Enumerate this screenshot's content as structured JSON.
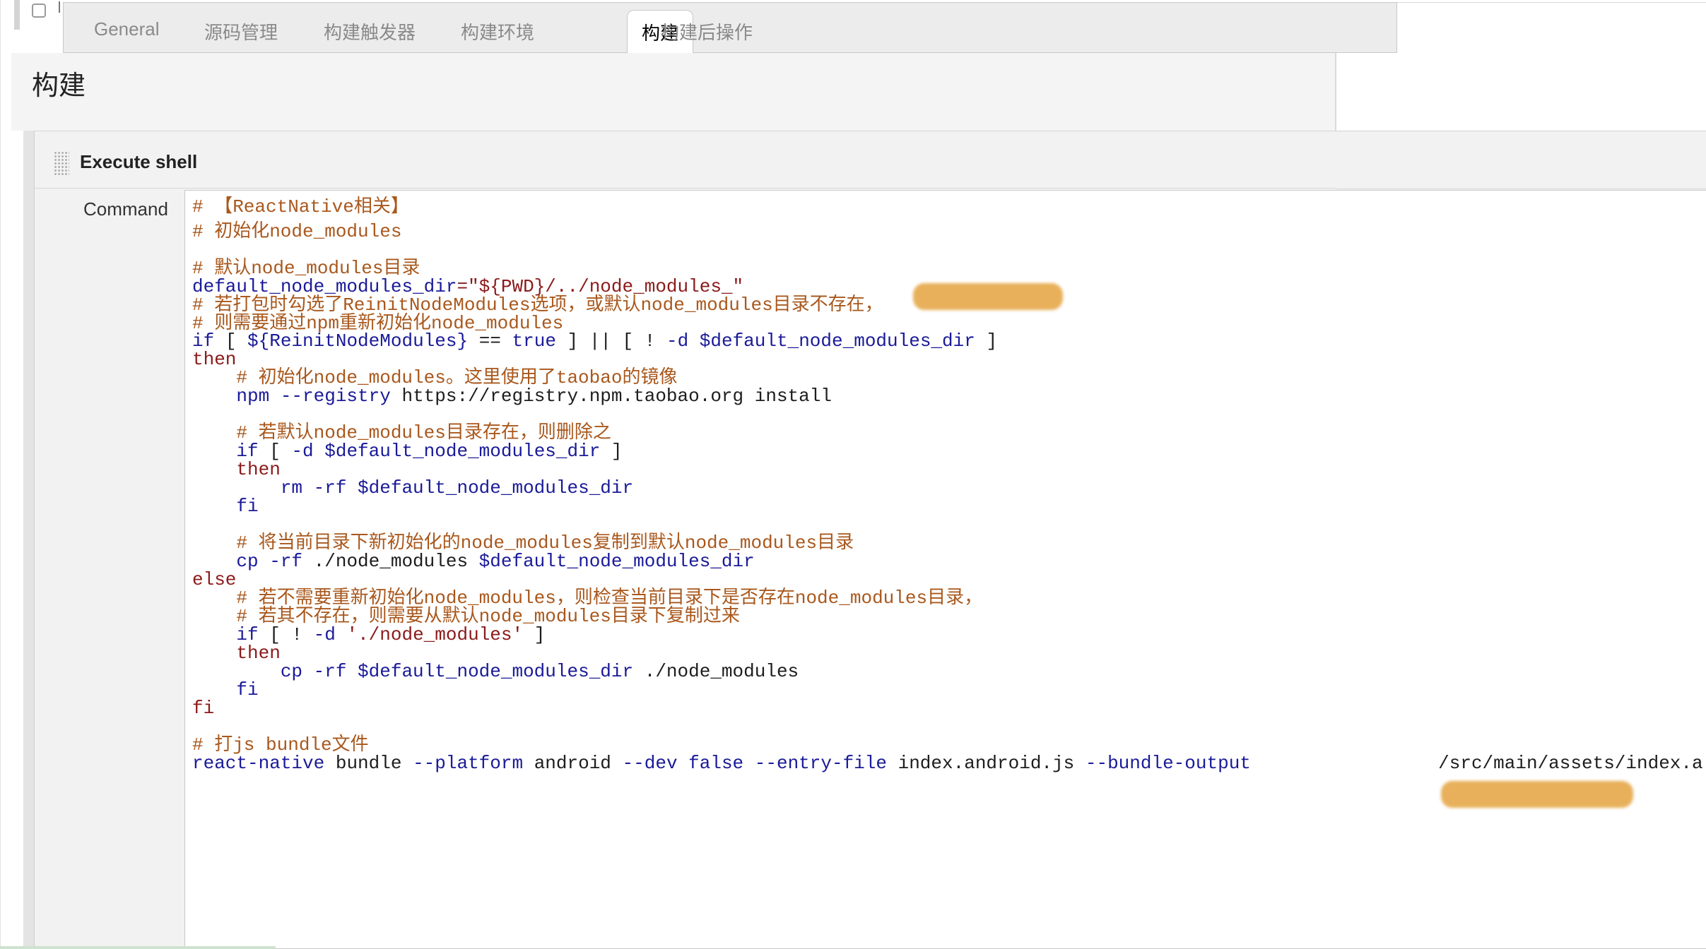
{
  "tabs": [
    "General",
    "源码管理",
    "构建触发器",
    "构建环境",
    "构建",
    "构建后操作"
  ],
  "active_tab": "构建",
  "section": {
    "title": "构建"
  },
  "step": {
    "title": "Execute shell",
    "command_label": "Command"
  },
  "icons": {
    "drag_handle": "drag-handle-icon"
  },
  "redaction_color": "#e8b05a",
  "code_lines": [
    [
      {
        "t": "# 【ReactNative相关】",
        "c": "cm"
      }
    ],
    [
      {
        "t": "# 初始化node_modules",
        "c": "cm"
      }
    ],
    [
      {
        "t": "# 默认node_modules目录",
        "c": "cm"
      }
    ],
    [
      {
        "t": "default_node_modules_dir",
        "c": "kw"
      },
      {
        "t": "=\"${PWD}/../node_modules_",
        "c": "st"
      },
      {
        "t": "\"",
        "c": "st"
      }
    ],
    [
      {
        "t": "# 若打包时勾选了ReinitNodeModules选项，或默认node_modules目录不存在，",
        "c": "cm"
      }
    ],
    [
      {
        "t": "# 则需要通过npm重新初始化node_modules",
        "c": "cm"
      }
    ],
    [
      {
        "t": "if",
        "c": "kw"
      },
      {
        "t": " [ ",
        "c": "pl"
      },
      {
        "t": "${ReinitNodeModules}",
        "c": "kw"
      },
      {
        "t": " == ",
        "c": "pl"
      },
      {
        "t": "true",
        "c": "kw"
      },
      {
        "t": " ] || [ ! ",
        "c": "pl"
      },
      {
        "t": "-d $default_node_modules_dir",
        "c": "kw"
      },
      {
        "t": " ]",
        "c": "pl"
      }
    ],
    [
      {
        "t": "then",
        "c": "st"
      }
    ],
    [
      {
        "t": "    # 初始化node_modules。这里使用了taobao的镜像",
        "c": "cm"
      }
    ],
    [
      {
        "t": "    npm --registry",
        "c": "kw"
      },
      {
        "t": " https://registry.npm.taobao.org install",
        "c": "pl"
      }
    ],
    [
      {
        "t": "    # 若默认node_modules目录存在，则删除之",
        "c": "cm"
      }
    ],
    [
      {
        "t": "    if",
        "c": "kw"
      },
      {
        "t": " [ ",
        "c": "pl"
      },
      {
        "t": "-d $default_node_modules_dir",
        "c": "kw"
      },
      {
        "t": " ]",
        "c": "pl"
      }
    ],
    [
      {
        "t": "    then",
        "c": "st"
      }
    ],
    [
      {
        "t": "        rm -rf $default_node_modules_dir",
        "c": "kw"
      }
    ],
    [
      {
        "t": "    fi",
        "c": "kw"
      }
    ],
    [
      {
        "t": "    # 将当前目录下新初始化的node_modules复制到默认node_modules目录",
        "c": "cm"
      }
    ],
    [
      {
        "t": "    cp -rf",
        "c": "kw"
      },
      {
        "t": " ./node_modules ",
        "c": "pl"
      },
      {
        "t": "$default_node_modules_dir",
        "c": "kw"
      }
    ],
    [
      {
        "t": "else",
        "c": "st"
      }
    ],
    [
      {
        "t": "    # 若不需要重新初始化node_modules，则检查当前目录下是否存在node_modules目录，",
        "c": "cm"
      }
    ],
    [
      {
        "t": "    # 若其不存在，则需要从默认node_modules目录下复制过来",
        "c": "cm"
      }
    ],
    [
      {
        "t": "    if",
        "c": "kw"
      },
      {
        "t": " [ ! ",
        "c": "pl"
      },
      {
        "t": "-d",
        "c": "kw"
      },
      {
        "t": " ",
        "c": "pl"
      },
      {
        "t": "'./node_modules'",
        "c": "st"
      },
      {
        "t": " ]",
        "c": "pl"
      }
    ],
    [
      {
        "t": "    then",
        "c": "st"
      }
    ],
    [
      {
        "t": "        cp -rf $default_node_modules_dir",
        "c": "kw"
      },
      {
        "t": " ./node_modules",
        "c": "pl"
      }
    ],
    [
      {
        "t": "    fi",
        "c": "kw"
      }
    ],
    [
      {
        "t": "fi",
        "c": "st"
      }
    ],
    [
      {
        "t": "# 打js bundle文件",
        "c": "cm"
      }
    ],
    [
      {
        "t": "react-native",
        "c": "kw"
      },
      {
        "t": " bundle ",
        "c": "pl"
      },
      {
        "t": "--platform",
        "c": "kw"
      },
      {
        "t": " android ",
        "c": "pl"
      },
      {
        "t": "--dev false --entry-file",
        "c": "kw"
      },
      {
        "t": " index.android.js ",
        "c": "pl"
      },
      {
        "t": "--bundle-output",
        "c": "kw"
      },
      {
        "t": "                 /src/main/assets/index.a",
        "c": "pl"
      }
    ]
  ]
}
